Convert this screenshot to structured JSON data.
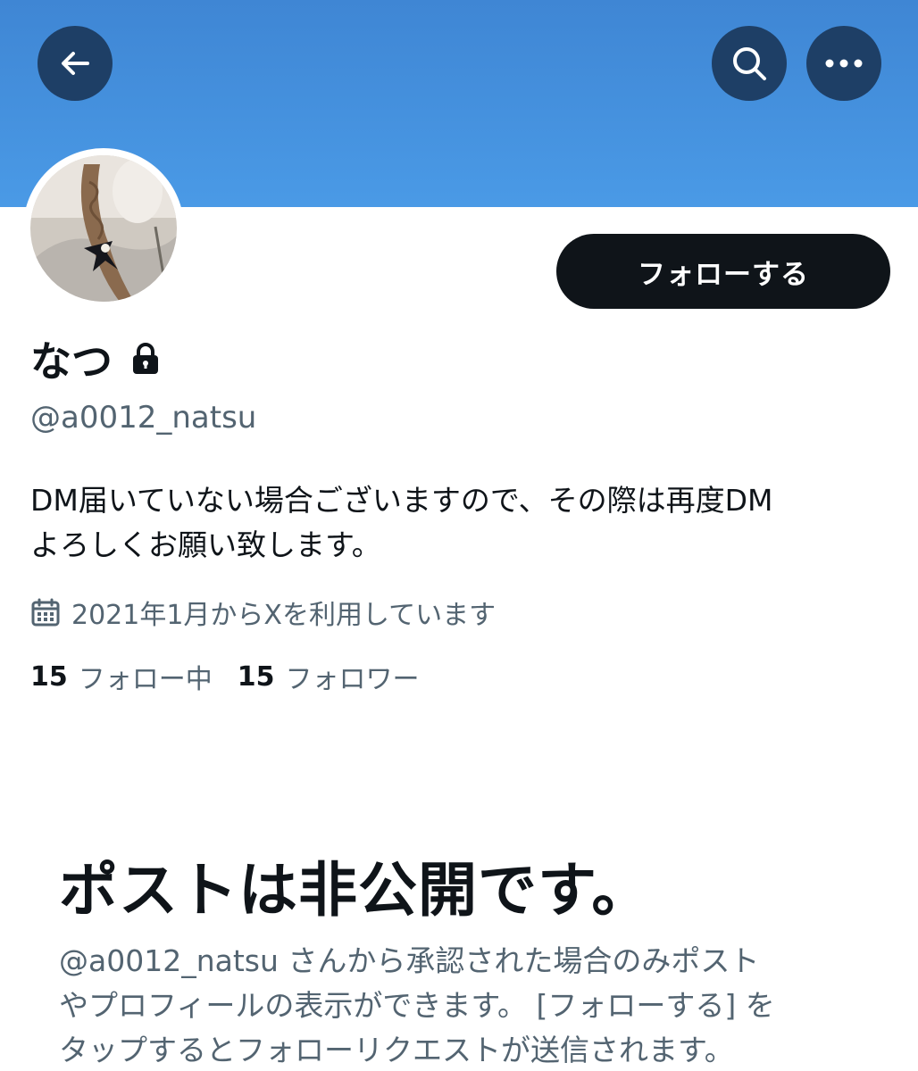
{
  "header": {
    "back_icon": "arrow-left-icon",
    "search_icon": "search-icon",
    "more_icon": "more-horizontal-icon",
    "banner_color": "#4a9ae6",
    "button_color": "#1e3f66"
  },
  "profile": {
    "display_name": "なつ",
    "handle": "@a0012_natsu",
    "bio_line1": "DM届いていない場合ございますので、その際は再度DM",
    "bio_line2": "よろしくお願い致します。",
    "joined": "2021年1月からXを利用しています",
    "following_count": "15",
    "following_label": "フォロー中",
    "followers_count": "15",
    "followers_label": "フォロワー",
    "follow_button": "フォローする",
    "protected_icon": "lock-icon",
    "calendar_icon": "calendar-icon"
  },
  "private_notice": {
    "title": "ポストは非公開です。",
    "line1": "@a0012_natsu さんから承認された場合のみポスト",
    "line2": "やプロフィールの表示ができます。 [フォローする] を",
    "line3": "タップするとフォローリクエストが送信されます。"
  }
}
